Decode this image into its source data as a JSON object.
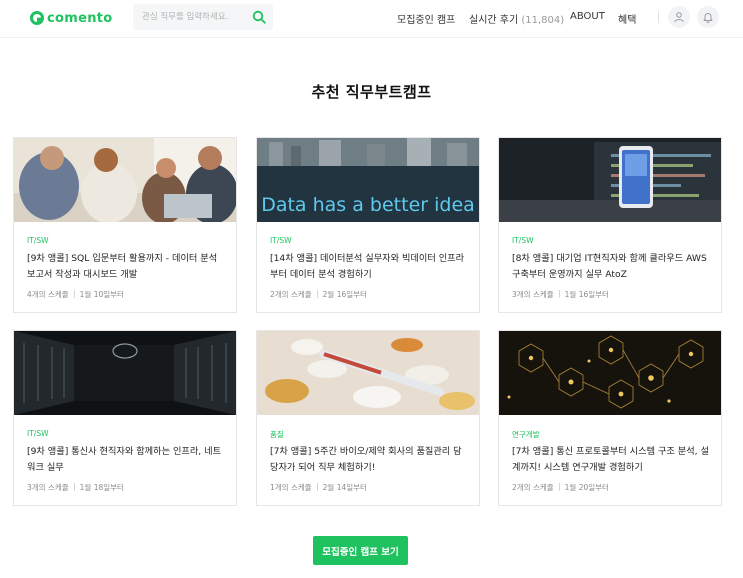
{
  "header": {
    "logo_text": "comento",
    "search_placeholder": "관심 직무를 입력하세요.",
    "nav": [
      {
        "label": "모집중인 캠프"
      },
      {
        "label": "실시간 후기",
        "count": "(11,804)"
      },
      {
        "label": "ABOUT"
      },
      {
        "label": "혜택"
      }
    ]
  },
  "section": {
    "title": "추천 직무부트캠프",
    "cta_label": "모집중인 캠프 보기"
  },
  "cards": [
    {
      "category": "IT/SW",
      "title": "[9차 앵콜] SQL 입문부터 활용까지 - 데이터 분석 보고서 작성과 대시보드 개발",
      "schedules": "4개의 스케쥴",
      "start": "1월 10일부터",
      "image": "office-meeting-photo"
    },
    {
      "category": "IT/SW",
      "title": "[14차 앵콜] 데이터분석 실무자와 빅데이터 인프라부터 데이터 분석 경험하기",
      "schedules": "2개의 스케쥴",
      "start": "2월 16일부터",
      "image": "data-has-a-better-idea",
      "image_text": "Data has a better idea"
    },
    {
      "category": "IT/SW",
      "title": "[8차 앵콜] 대기업 IT현직자와 함께 클라우드 AWS 구축부터 운영까지 실무 AtoZ",
      "schedules": "3개의 스케쥴",
      "start": "1월 16일부터",
      "image": "laptop-phone-photo"
    },
    {
      "category": "IT/SW",
      "title": "[9차 앵콜] 통신사 현직자와 함께하는 인프라, 네트워크 실무",
      "schedules": "3개의 스케쥴",
      "start": "1월 18일부터",
      "image": "server-room-photo"
    },
    {
      "category": "품질",
      "title": "[7차 앵콜] 5주간 바이오/제약 회사의 품질관리 담당자가 되어 직무 체험하기!",
      "schedules": "1개의 스케쥴",
      "start": "2월 14일부터",
      "image": "pills-thermometer-photo"
    },
    {
      "category": "연구개발",
      "title": "[7차 앵콜] 통신 프로토콜부터 시스템 구조 분석, 설계까지! 시스템 연구개발 경험하기",
      "schedules": "2개의 스케쥴",
      "start": "1월 20일부터",
      "image": "gold-network-photo"
    }
  ],
  "colors": {
    "accent": "#1ec25e",
    "text": "#222222",
    "muted": "#8b8b8b"
  }
}
